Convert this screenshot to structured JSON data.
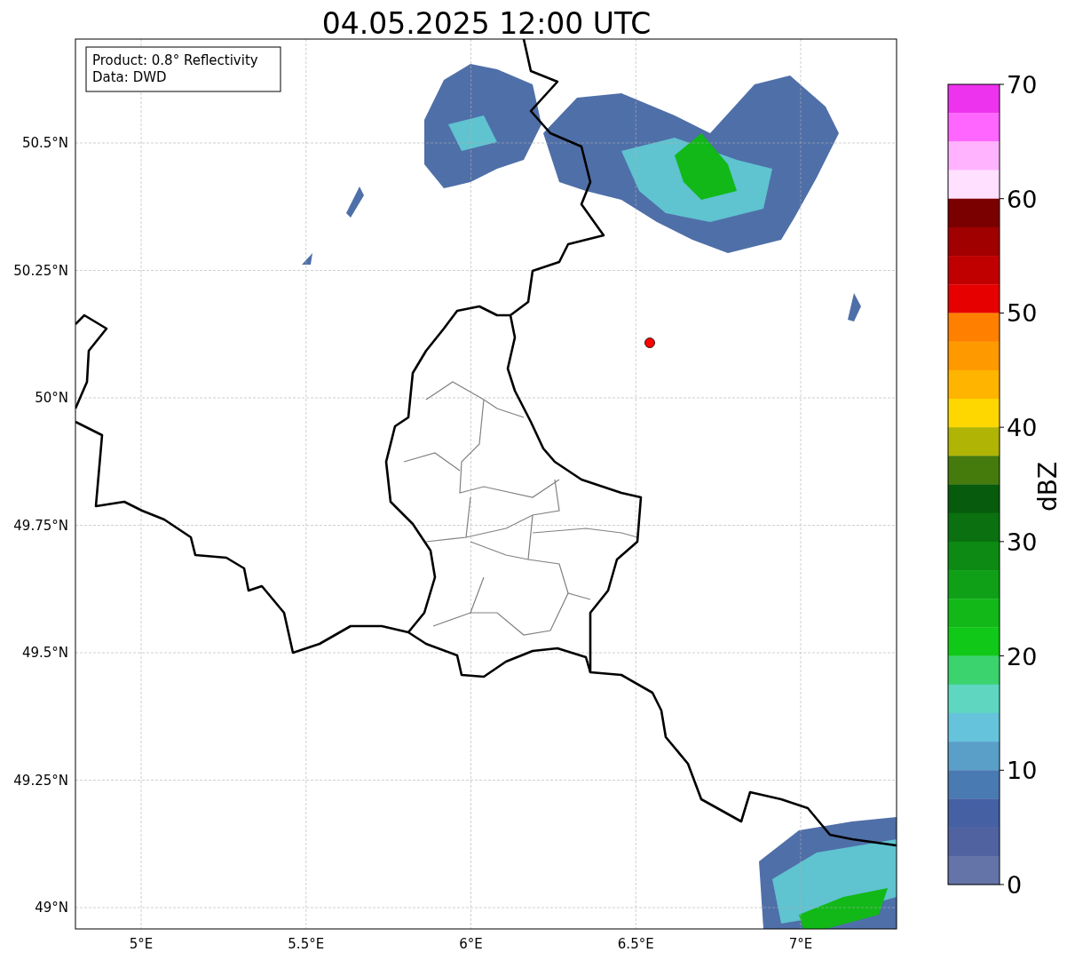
{
  "title": "04.05.2025 12:00 UTC",
  "info_box": [
    "Product: 0.8° Reflectivity",
    "Data: DWD"
  ],
  "y_ticks": [
    "50.5°N",
    "50.25°N",
    "50°N",
    "49.75°N",
    "49.5°N",
    "49.25°N",
    "49°N"
  ],
  "x_ticks": [
    "5°E",
    "5.5°E",
    "6°E",
    "6.5°E",
    "7°E"
  ],
  "colorbar": {
    "label": "dBZ",
    "ticks": [
      "70",
      "60",
      "50",
      "40",
      "30",
      "20",
      "10",
      "0"
    ],
    "bins": [
      {
        "color": "#ee33ee"
      },
      {
        "color": "#ff66ff"
      },
      {
        "color": "#ffb3ff"
      },
      {
        "color": "#ffe0ff"
      },
      {
        "color": "#7a0000"
      },
      {
        "color": "#a00000"
      },
      {
        "color": "#c00000"
      },
      {
        "color": "#e60000"
      },
      {
        "color": "#ff7f00"
      },
      {
        "color": "#ff9900"
      },
      {
        "color": "#ffb400"
      },
      {
        "color": "#ffd700"
      },
      {
        "color": "#b0b404"
      },
      {
        "color": "#457a0c"
      },
      {
        "color": "#065b0c"
      },
      {
        "color": "#0a7010"
      },
      {
        "color": "#0d8a13"
      },
      {
        "color": "#10a018"
      },
      {
        "color": "#11b818"
      },
      {
        "color": "#10c818"
      },
      {
        "color": "#3ad36e"
      },
      {
        "color": "#5fd6c0"
      },
      {
        "color": "#66c3dc"
      },
      {
        "color": "#5a9fc8"
      },
      {
        "color": "#4a7ab2"
      },
      {
        "color": "#4560a3"
      },
      {
        "color": "#5062a0"
      },
      {
        "color": "#6574a8"
      }
    ]
  }
}
